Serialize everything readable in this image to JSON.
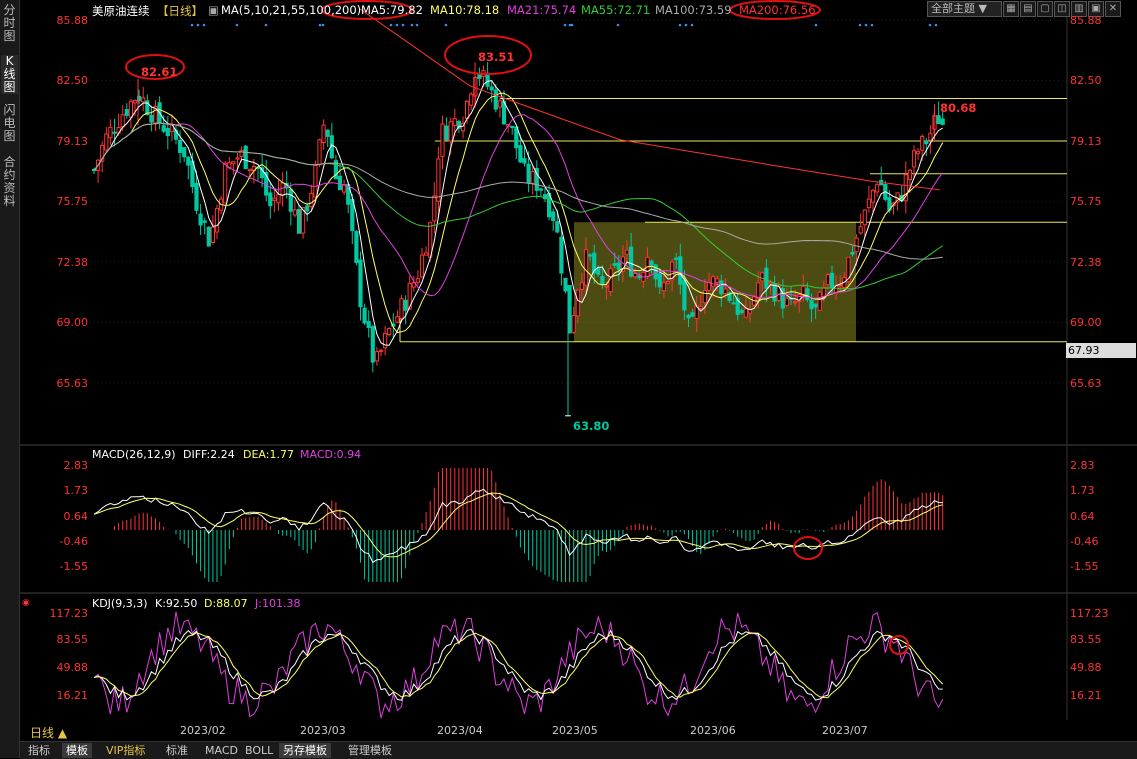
{
  "sidebar": {
    "tabs": [
      "分时图",
      "K线图",
      "闪电图",
      "合约资料"
    ]
  },
  "header": {
    "instrument": "美原油连续",
    "period_tag": "【日线】",
    "ma_prefix": "MA(5,10,21,55,100,200)",
    "ma5": "MA5:79.82",
    "ma10": "MA10:78.18",
    "ma21": "MA21:75.74",
    "ma55": "MA55:72.71",
    "ma100": "MA100:73.59",
    "ma200": "MA200:76.56",
    "theme_button": "全部主题",
    "theme_arrow": "▼"
  },
  "colors": {
    "up": "#ff3333",
    "down": "#00c8a0",
    "ma5": "#ffffff",
    "ma10": "#ffff66",
    "ma21": "#e040e0",
    "ma55": "#33cc33",
    "ma100": "#aaaaaa",
    "ma200": "#ff3333",
    "diff": "#ffffff",
    "dea": "#ffff66",
    "macd": "#e040e0",
    "annot": "#e01010",
    "box": "#8a8a20"
  },
  "price_axis": [
    "85.88",
    "82.50",
    "79.13",
    "75.75",
    "72.38",
    "69.00",
    "65.63"
  ],
  "price_tag": "67.93",
  "annotations": {
    "high1": "82.61",
    "high2": "83.51",
    "last": "80.68",
    "low": "63.80"
  },
  "macd": {
    "title": "MACD(26,12,9)",
    "diff": "DIFF:2.24",
    "dea": "DEA:1.77",
    "macd": "MACD:0.94",
    "axis": [
      "2.83",
      "1.73",
      "0.64",
      "-0.46",
      "-1.55"
    ]
  },
  "kdj": {
    "title": "KDJ(9,3,3)",
    "k": "K:92.50",
    "d": "D:88.07",
    "j": "J:101.38",
    "axis": [
      "117.23",
      "83.55",
      "49.88",
      "16.21"
    ]
  },
  "dates": [
    "2023/02",
    "2023/03",
    "2023/04",
    "2023/05",
    "2023/06",
    "2023/07"
  ],
  "period_label": "日线 ▲",
  "bottom_tabs": [
    "指标",
    "模板",
    "VIP指标",
    "标准",
    "MACD",
    "BOLL",
    "另存模板",
    "管理模板"
  ],
  "chart_data": {
    "type": "candlestick",
    "title": "美原油连续【日线】",
    "ylim": [
      63.0,
      86.5
    ],
    "notable_values": {
      "high_feb": 82.61,
      "high_apr": 83.51,
      "low_may": 63.8,
      "last_high": 80.68
    },
    "horizontal_levels": [
      81.5,
      79.13,
      77.3,
      74.6,
      67.93
    ]
  }
}
